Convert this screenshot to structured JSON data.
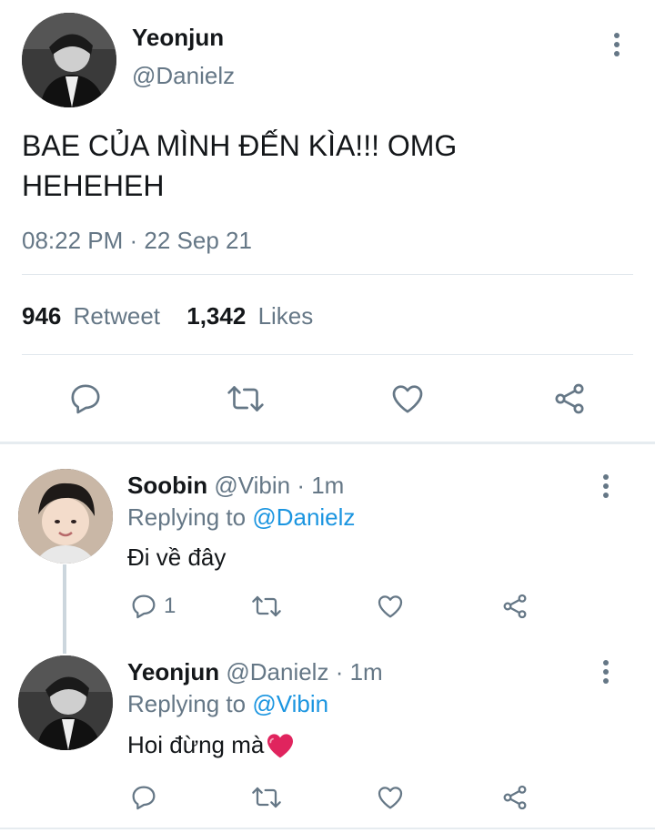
{
  "main_tweet": {
    "author_name": "Yeonjun",
    "author_handle": "@Danielz",
    "text_line1": "BAE CỦA MÌNH ĐẾN KÌA!!! OMG",
    "text_line2": "HEHEHEH",
    "timestamp": "08:22 PM · 22 Sep 21",
    "retweet_count": "946",
    "retweet_label": "Retweet",
    "like_count": "1,342",
    "like_label": "Likes"
  },
  "replies": [
    {
      "author_name": "Soobin",
      "author_handle": "@Vibin",
      "time": "· 1m",
      "replying_prefix": "Replying to",
      "replying_to": "@Danielz",
      "text": "Đi về đây",
      "reply_count": "1"
    },
    {
      "author_name": "Yeonjun",
      "author_handle": "@Danielz",
      "time": "· 1m",
      "replying_prefix": "Replying to",
      "replying_to": "@Vibin",
      "text": "Hoi đừng mà",
      "emoji": "heart-emoji"
    }
  ],
  "icons": [
    "more-vertical-icon",
    "reply-icon",
    "retweet-icon",
    "like-icon",
    "share-icon"
  ],
  "colors": {
    "text": "#14171a",
    "secondary": "#657786",
    "link": "#1b95e0",
    "divider": "#e1e8ed",
    "heart": "#e0245e"
  }
}
